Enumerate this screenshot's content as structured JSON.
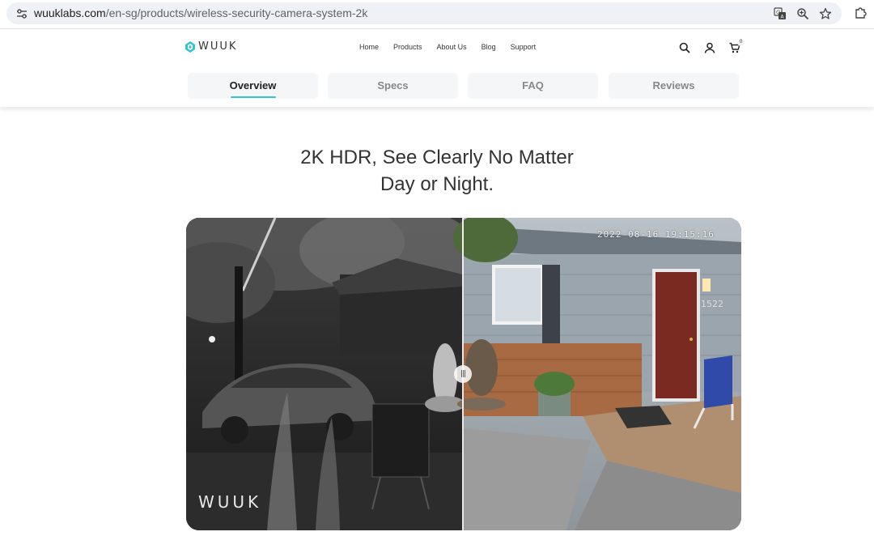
{
  "browser": {
    "url_host": "wuuklabs.com",
    "url_path": "/en-sg/products/wireless-security-camera-system-2k",
    "icons": [
      "tune-icon",
      "translate-icon",
      "zoom-icon",
      "bookmark-star-icon",
      "extensions-icon"
    ]
  },
  "header": {
    "logo_text": "WUUK",
    "nav": [
      "Home",
      "Products",
      "About Us",
      "Blog",
      "Support"
    ],
    "cart_count": "0",
    "icons": [
      "search-icon",
      "account-icon",
      "cart-icon"
    ],
    "accent_color": "#35c3d2"
  },
  "tabs": [
    {
      "label": "Overview",
      "active": true
    },
    {
      "label": "Specs",
      "active": false
    },
    {
      "label": "FAQ",
      "active": false
    },
    {
      "label": "Reviews",
      "active": false
    }
  ],
  "main": {
    "headline_line1": "2K HDR, See Clearly No Matter",
    "headline_line2": "Day or Night.",
    "comparison": {
      "left_label": "night-vision",
      "right_label": "day-color",
      "timestamp": "2022-08-16 19:15:16",
      "watermark": "WUUK",
      "house_number": "1522",
      "handle_glyph": "|||"
    }
  }
}
